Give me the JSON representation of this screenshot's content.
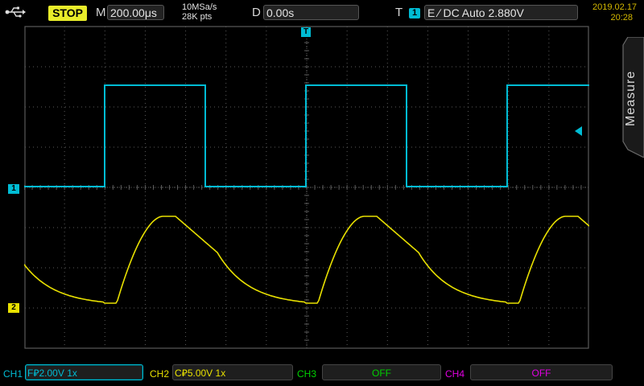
{
  "status": {
    "run_state": "STOP",
    "timebase_label": "M",
    "timebase_value": "200.00μs",
    "sample_rate": "10MSa/s",
    "memory_depth": "28K pts",
    "delay_label": "D",
    "delay_value": "0.00s",
    "trigger_label": "T",
    "trigger_channel": "1",
    "trigger_info": "E ∕ DC Auto 2.880V",
    "date": "2019.02.17",
    "time": "20:28",
    "usb_icon": "usb-icon"
  },
  "side_panel": {
    "measure_label": "Measure"
  },
  "markers": {
    "ch1": "1",
    "ch2": "2",
    "trigger_position": "T"
  },
  "channels": [
    {
      "name": "CH1",
      "coupling": "F",
      "scale": "2.00V",
      "probe": "1x",
      "color": "#00bcd4",
      "text_color": "#00bcd4"
    },
    {
      "name": "CH2",
      "coupling": "C",
      "scale": "5.00V",
      "probe": "1x",
      "color": "#e8e000",
      "text_color": "#e8e000"
    },
    {
      "name": "CH3",
      "state": "OFF",
      "color": "#00d000"
    },
    {
      "name": "CH4",
      "state": "OFF",
      "color": "#e000e0"
    }
  ],
  "colors": {
    "ch1": "#00bcd4",
    "ch2": "#e8e000",
    "grid": "#5a5a5a",
    "date": "#d4b800"
  }
}
